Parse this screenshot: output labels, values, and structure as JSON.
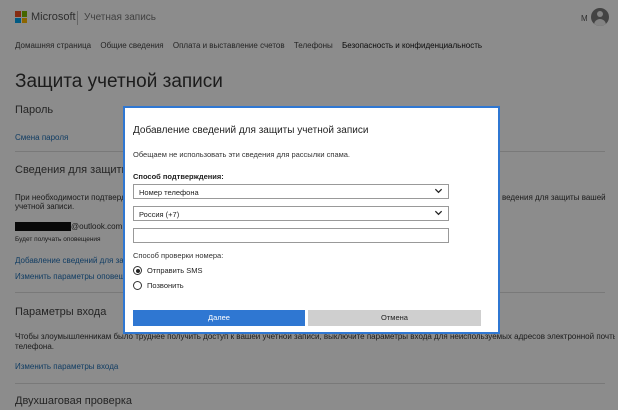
{
  "header": {
    "brand": "Microsoft",
    "section": "Учетная запись",
    "user_initial": "М"
  },
  "nav": {
    "items": [
      "Домашняя страница",
      "Общие сведения",
      "Оплата и выставление счетов",
      "Телефоны",
      "Безопасность и конфиденциальность"
    ],
    "active_index": 4
  },
  "page": {
    "title": "Защита учетной записи",
    "password_heading": "Пароль",
    "change_password_link": "Смена пароля",
    "security_info_heading": "Сведения для защиты учетн",
    "security_info_text_left": "При необходимости подтверд",
    "security_info_text_right": "ведения для защиты вашей",
    "security_info_text_line2": "учетной записи.",
    "email_suffix": "@outlook.com",
    "email_note": "Будет получать оповещения",
    "add_security_info_link": "Добавление сведений для защи",
    "change_alert_settings_link": "Изменить параметры оповещ",
    "signin_heading": "Параметры входа",
    "signin_text_line1": "Чтобы злоумышленникам было труднее получить доступ к вашей учетной записи, выключите параметры входа для неиспользуемых адресов электронной почты и номеров",
    "signin_text_line2": "телефона.",
    "change_signin_link": "Изменить параметры входа",
    "two_step_heading": "Двухшаговая проверка"
  },
  "dialog": {
    "title": "Добавление сведений для защиты учетной записи",
    "subtitle": "Обещаем не использовать эти сведения для рассылки спама.",
    "method_label": "Способ подтверждения:",
    "method_value": "Номер телефона",
    "country_value": "Россия (+7)",
    "phone_value": "",
    "verify_label": "Способ проверки номера:",
    "option_sms": "Отправить SMS",
    "option_call": "Позвонить",
    "next_label": "Далее",
    "cancel_label": "Отмена"
  },
  "colors": {
    "accent": "#2f77d2",
    "link": "#1f6fb5",
    "logo_red": "#f25022",
    "logo_green": "#7fba00",
    "logo_blue": "#00a4ef",
    "logo_yellow": "#ffb900"
  }
}
